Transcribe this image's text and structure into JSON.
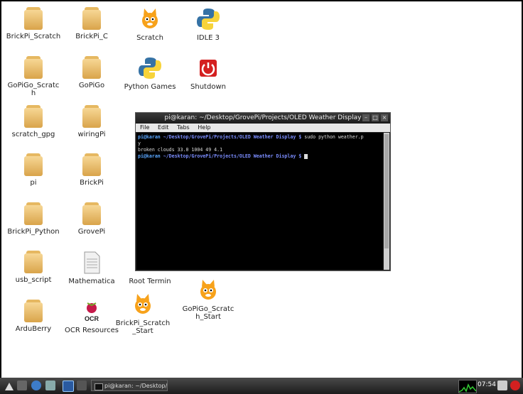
{
  "desktop_icons": [
    {
      "label": "BrickPi_Scratch",
      "icon": "folder-icon"
    },
    {
      "label": "BrickPi_C",
      "icon": "folder-icon"
    },
    {
      "label": "Scratch",
      "icon": "scratch-cat-icon"
    },
    {
      "label": "IDLE 3",
      "icon": "python-icon"
    },
    {
      "label": "GoPiGo_Scratc\nh",
      "icon": "folder-icon"
    },
    {
      "label": "GoPiGo",
      "icon": "folder-icon"
    },
    {
      "label": "Python Games",
      "icon": "python-icon"
    },
    {
      "label": "Shutdown",
      "icon": "power-icon"
    },
    {
      "label": "scratch_gpg",
      "icon": "folder-icon"
    },
    {
      "label": "wiringPi",
      "icon": "folder-icon"
    },
    {
      "label": "pi",
      "icon": "folder-icon"
    },
    {
      "label": "BrickPi",
      "icon": "folder-icon"
    },
    {
      "label": "BrickPi_Python",
      "icon": "folder-icon"
    },
    {
      "label": "GrovePi",
      "icon": "folder-icon"
    },
    {
      "label": "usb_script",
      "icon": "folder-icon"
    },
    {
      "label": "Mathematica",
      "icon": "document-icon"
    },
    {
      "label": "Root Termin",
      "icon": "terminal-icon"
    },
    {
      "label": "ArduBerry",
      "icon": "folder-icon"
    },
    {
      "label": "OCR Resources",
      "icon": "raspberry-icon"
    },
    {
      "label": "BrickPi_Scratch\n_Start",
      "icon": "scratch-cat-icon"
    },
    {
      "label": "GoPiGo_Scratc\nh_Start",
      "icon": "scratch-cat-icon"
    }
  ],
  "terminal": {
    "title": "pi@karan: ~/Desktop/GrovePi/Projects/OLED Weather Display",
    "menu": [
      "File",
      "Edit",
      "Tabs",
      "Help"
    ],
    "lines": [
      {
        "user": "pi@karan",
        "path": " ~/Desktop/GrovePi/Projects/OLED Weather Display $",
        "cmd": " sudo python weather.p"
      },
      {
        "text": "y"
      },
      {
        "text": "broken clouds 33.0 1004 49 4.1"
      },
      {
        "user": "pi@karan",
        "path": " ~/Desktop/GrovePi/Projects/OLED Weather Display $",
        "cmd": " "
      }
    ]
  },
  "taskbar": {
    "task_label": "pi@karan: ~/Desktop/G...",
    "clock": "07:54"
  },
  "colors": {
    "folder": "#e6b861",
    "terminal_bg": "#000000",
    "prompt": "#5aa7ff",
    "power": "#d42020"
  }
}
